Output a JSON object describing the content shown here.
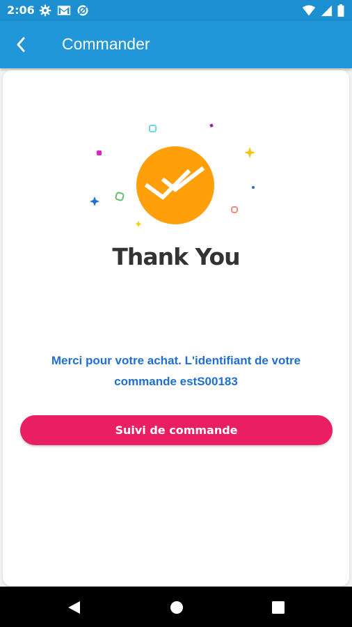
{
  "status_bar": {
    "time": "2:06",
    "left_icons": [
      "settings-icon",
      "gmail-icon",
      "sync-icon"
    ],
    "right_icons": [
      "wifi-icon",
      "cellular-signal-icon",
      "battery-icon"
    ]
  },
  "app_bar": {
    "title": "Commander",
    "back_icon": "chevron-left-icon"
  },
  "content": {
    "illustration_icon": "double-check-icon",
    "heading": "Thank You",
    "message": "Merci pour votre achat. L'identifiant de votre commande estS00183",
    "track_button_label": "Suivi de commande"
  },
  "colors": {
    "primary": "#2196d8",
    "status_bar": "#1b8fcf",
    "accent": "#e91e63",
    "badge": "#ff9f0a",
    "message_text": "#1e6fd1"
  },
  "nav_bar": {
    "buttons": [
      "back-triangle-icon",
      "home-circle-icon",
      "recents-square-icon"
    ]
  }
}
